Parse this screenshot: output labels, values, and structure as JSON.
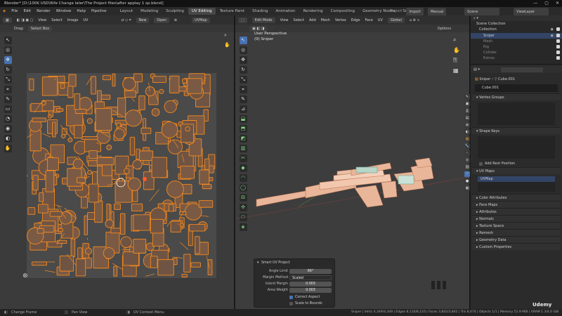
{
  "titlebar": {
    "title": "Blender* [D:\\100K USD\\Rife Change later\\The Project files\\after applay 1 sp.blend]",
    "minimize": "—",
    "maximize": "▢",
    "close": "✕"
  },
  "menu": {
    "logo": "◈",
    "items": [
      "File",
      "Edit",
      "Render",
      "Window",
      "Help",
      "Pipeline"
    ]
  },
  "workspaces": [
    "Layout",
    "Modeling",
    "Sculpting",
    "UV Editing",
    "Texture Paint",
    "Shading",
    "Animation",
    "Rendering",
    "Compositing",
    "Geometry Nodes",
    "Scripting"
  ],
  "top_right": {
    "export": "Export",
    "import": "Import",
    "manual": "Manual",
    "scene": "Scene",
    "viewlayer": "ViewLayer"
  },
  "uv_header": {
    "view": "View",
    "select": "Select",
    "image": "Image",
    "uv": "UV",
    "new": "New",
    "open": "Open",
    "uvmap": "UVMap"
  },
  "uv_subheader": {
    "drag": "Drag:",
    "select_box": "Select Box"
  },
  "vp_header": {
    "mode": "Edit Mode",
    "view": "View",
    "select": "Select",
    "add": "Add",
    "mesh": "Mesh",
    "vertex": "Vertex",
    "edge": "Edge",
    "face": "Face",
    "uv": "UV",
    "orientation": "Global",
    "options": "Options"
  },
  "vp_overlay": {
    "line1": "User Perspective",
    "line2": "(0) Sniper"
  },
  "outliner": {
    "header": "Scene Collection",
    "rows": [
      "Collection",
      "Sniper",
      "Mesh",
      "Rig",
      "Collider",
      "Extras"
    ]
  },
  "properties": {
    "breadcrumb_obj": "Sniper",
    "breadcrumb_mesh": "Cube.001",
    "mesh_name": "Cube.001",
    "sections": {
      "vertex_groups": "Vertex Groups",
      "shape_keys": "Shape Keys",
      "add_rest": "Add Rest Position",
      "uv_maps": "UV Maps",
      "uvmap_item": "UVMap"
    },
    "collapsed": [
      "Color Attributes",
      "Face Maps",
      "Attributes",
      "Normals",
      "Texture Space",
      "Remesh",
      "Geometry Data",
      "Custom Properties"
    ]
  },
  "redo_panel": {
    "title": "Smart UV Project",
    "angle_label": "Angle Limit",
    "angle_value": "66°",
    "margin_method_label": "Margin Method",
    "margin_method_value": "Scaled",
    "island_margin_label": "Island Margin",
    "island_margin_value": "0.003",
    "area_weight_label": "Area Weight",
    "area_weight_value": "0.003",
    "correct_aspect": "Correct Aspect",
    "scale_bounds": "Scale to Bounds"
  },
  "statusbar": {
    "left1": "Change Frame",
    "left2": "Pan View",
    "left3": "UV Context Menu",
    "right": "Sniper | Verts 4,349/4,349 | Edges 8,110/8,110 | Faces 3,842/3,842 | Tris 8,474 | Objects 1/1 | Memory 51.9 MiB | VRAM 1.3/4.0 GiB | 3.4.0"
  },
  "colors": {
    "uv_orange": "#f5891e",
    "accent_blue": "#4772b3",
    "bg_dark": "#1d1d1d"
  },
  "watermark": "Udemy"
}
